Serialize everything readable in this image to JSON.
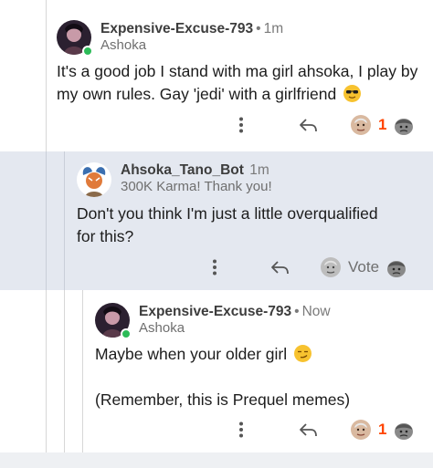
{
  "comments": [
    {
      "username": "Expensive-Excuse-793",
      "separator": "•",
      "time": "1m",
      "flair": "Ashoka",
      "body": "It's a good job I stand with ma girl ahsoka, I play by my own rules. Gay 'jedi' with a girlfriend",
      "emoji": "sunglasses-emoji",
      "vote_count": "1",
      "online": true
    },
    {
      "username": "Ahsoka_Tano_Bot",
      "time": "1m",
      "flair": "300K Karma! Thank you!",
      "body_line1": "Don't you think I'm just a little overqualified",
      "body_line2": "for this?",
      "vote_label": "Vote",
      "online": false
    },
    {
      "username": "Expensive-Excuse-793",
      "separator": "•",
      "time": "Now",
      "flair": "Ashoka",
      "body_line1": "Maybe when your older girl",
      "body_line2": "(Remember, this is Prequel memes)",
      "emoji": "smirk-emoji",
      "vote_count": "1",
      "online": true
    }
  ],
  "icons": {
    "more": "more-vertical-icon",
    "reply": "reply-icon",
    "upvote": "upvote-award-icon",
    "downvote": "downvote-icon"
  },
  "colors": {
    "highlight": "#e4e8f0",
    "vote_orange": "#ff4500",
    "online_green": "#2dbb58"
  }
}
